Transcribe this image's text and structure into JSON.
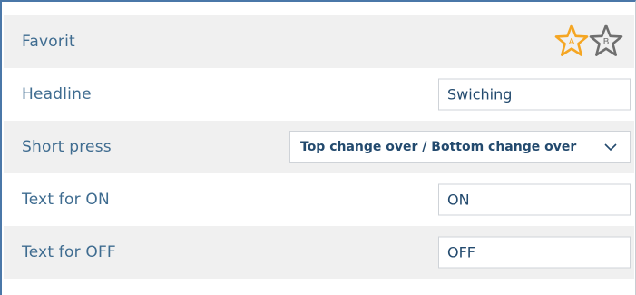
{
  "form": {
    "rows": [
      {
        "label": "Favorit"
      },
      {
        "label": "Headline",
        "value": "Swiching"
      },
      {
        "label": "Short press",
        "selected": "Top change over / Bottom change over"
      },
      {
        "label": "Text for ON",
        "value": "ON"
      },
      {
        "label": "Text for OFF",
        "value": "OFF"
      }
    ]
  },
  "favorites": {
    "a": {
      "letter": "A",
      "icon": "star-icon",
      "color": "#f5a623"
    },
    "b": {
      "letter": "B",
      "icon": "star-icon",
      "color": "#7a7a7a"
    }
  },
  "colors": {
    "label": "#3f6c90",
    "value": "#234a6e",
    "row_alt": "#f0f0f0",
    "accent_border": "#4a77a8"
  }
}
